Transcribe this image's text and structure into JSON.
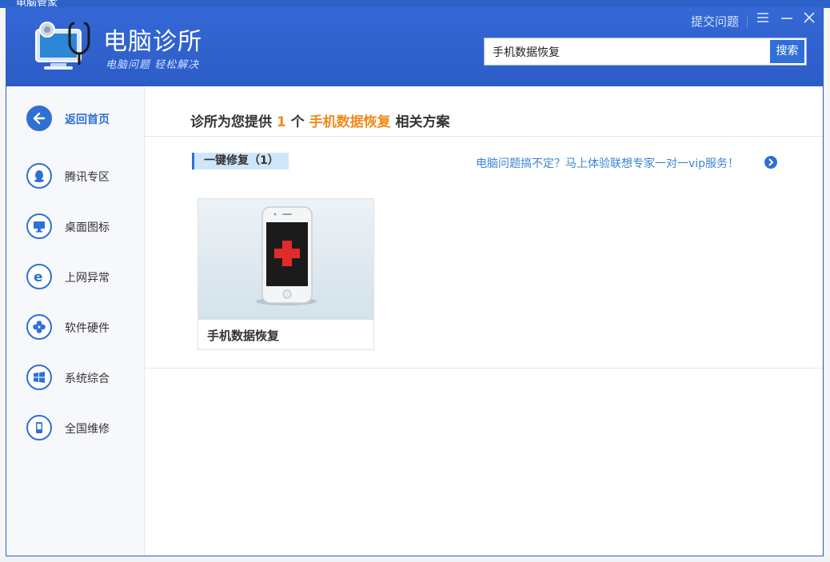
{
  "background_app": {
    "title": "电脑管家"
  },
  "header": {
    "app_title": "电脑诊所",
    "app_subtitle": "电脑问题 轻松解决",
    "submit_link": "提交问题",
    "search_value": "手机数据恢复",
    "search_button": "搜索"
  },
  "sidebar": {
    "items": [
      {
        "label": "返回首页",
        "icon": "back-arrow-icon"
      },
      {
        "label": "腾讯专区",
        "icon": "qq-penguin-icon"
      },
      {
        "label": "桌面图标",
        "icon": "monitor-icon"
      },
      {
        "label": "上网异常",
        "icon": "ie-browser-icon"
      },
      {
        "label": "软件硬件",
        "icon": "clover-icon"
      },
      {
        "label": "系统综合",
        "icon": "windows-icon"
      },
      {
        "label": "全国维修",
        "icon": "phone-repair-icon"
      }
    ]
  },
  "main": {
    "result_prefix": "诊所为您提供",
    "result_count": "1",
    "result_unit": "个",
    "result_keyword": "手机数据恢复",
    "result_suffix": "相关方案",
    "category_tag": "一键修复（1）",
    "vip_link": "电脑问题搞不定？马上体验联想专家一对一vip服务！",
    "cards": [
      {
        "label": "手机数据恢复",
        "icon": "phone-medical-icon"
      }
    ]
  },
  "colors": {
    "accent": "#2f70d5",
    "header": "#3568d6",
    "highlight": "#f08a1c"
  }
}
